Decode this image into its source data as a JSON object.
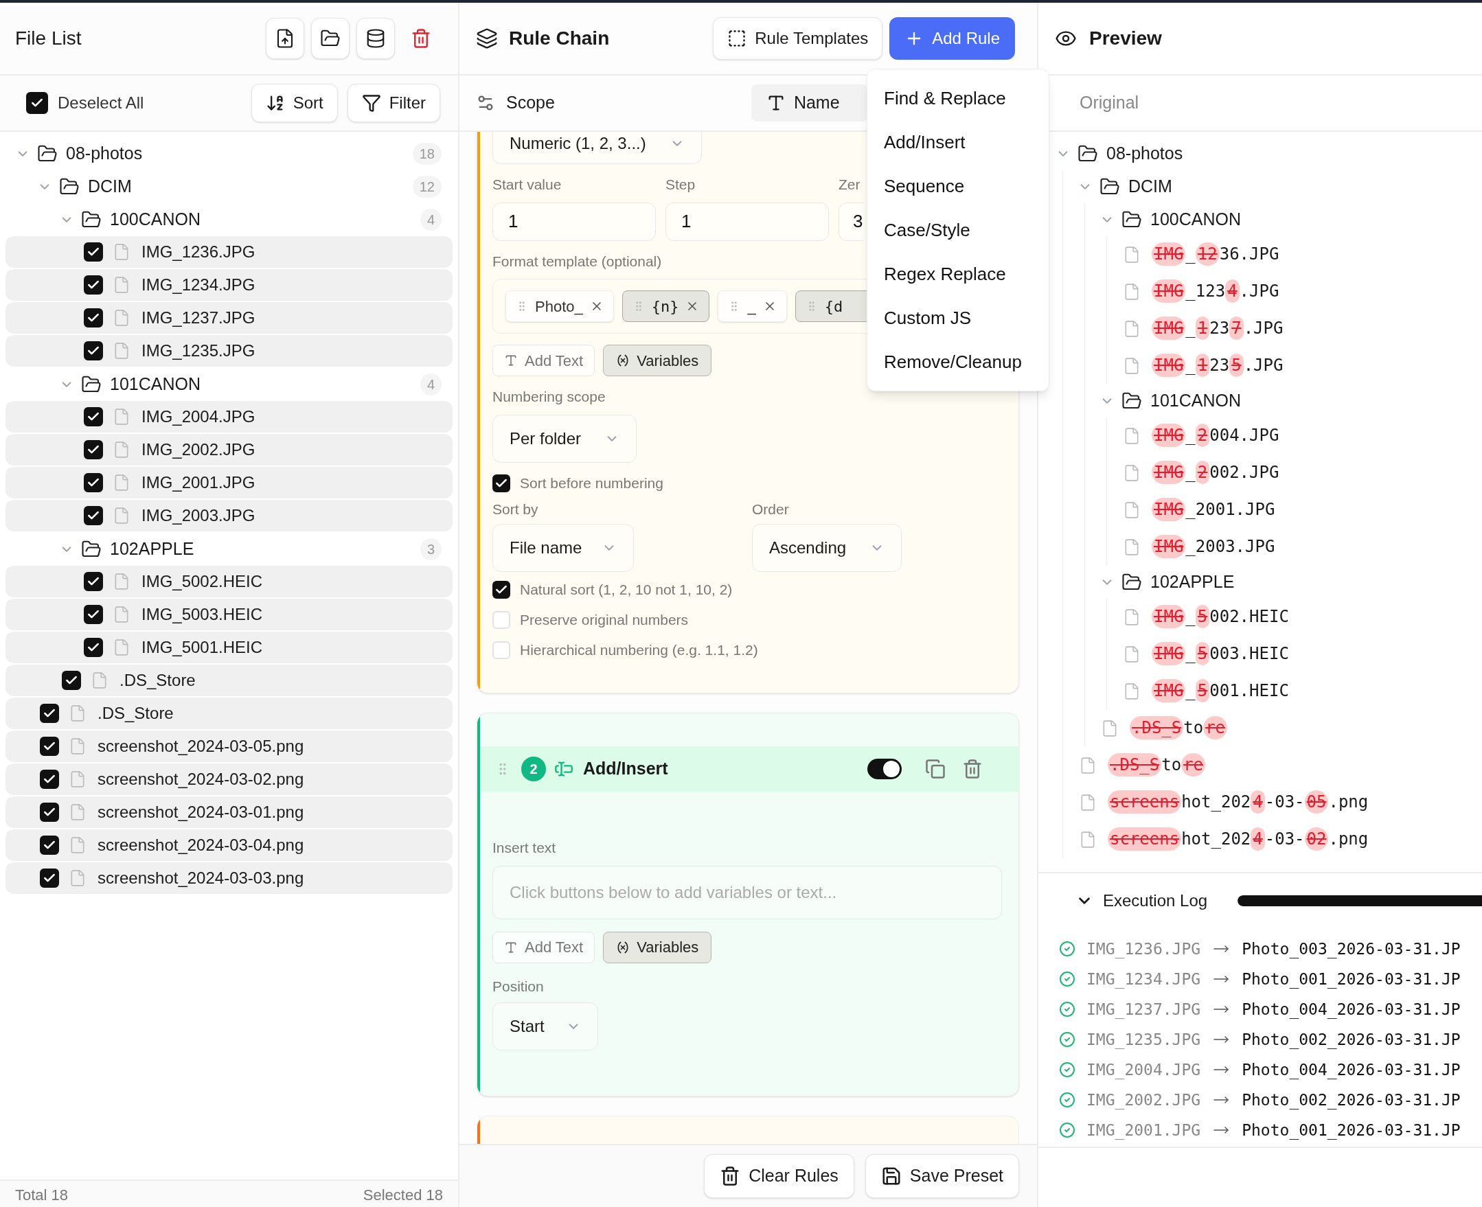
{
  "file_list": {
    "title": "File List",
    "select_all": {
      "label": "Deselect All",
      "checked": true
    },
    "sort_button": "Sort",
    "filter_button": "Filter",
    "tree": [
      {
        "kind": "folder",
        "name": "08-photos",
        "count": "18",
        "expanded": true,
        "children": [
          {
            "kind": "folder",
            "name": "DCIM",
            "count": "12",
            "expanded": true,
            "children": [
              {
                "kind": "folder",
                "name": "100CANON",
                "count": "4",
                "expanded": true,
                "children": [
                  {
                    "kind": "file",
                    "name": "IMG_1236.JPG",
                    "checked": true
                  },
                  {
                    "kind": "file",
                    "name": "IMG_1234.JPG",
                    "checked": true
                  },
                  {
                    "kind": "file",
                    "name": "IMG_1237.JPG",
                    "checked": true
                  },
                  {
                    "kind": "file",
                    "name": "IMG_1235.JPG",
                    "checked": true
                  }
                ]
              },
              {
                "kind": "folder",
                "name": "101CANON",
                "count": "4",
                "expanded": true,
                "children": [
                  {
                    "kind": "file",
                    "name": "IMG_2004.JPG",
                    "checked": true
                  },
                  {
                    "kind": "file",
                    "name": "IMG_2002.JPG",
                    "checked": true
                  },
                  {
                    "kind": "file",
                    "name": "IMG_2001.JPG",
                    "checked": true
                  },
                  {
                    "kind": "file",
                    "name": "IMG_2003.JPG",
                    "checked": true
                  }
                ]
              },
              {
                "kind": "folder",
                "name": "102APPLE",
                "count": "3",
                "expanded": true,
                "children": [
                  {
                    "kind": "file",
                    "name": "IMG_5002.HEIC",
                    "checked": true
                  },
                  {
                    "kind": "file",
                    "name": "IMG_5003.HEIC",
                    "checked": true
                  },
                  {
                    "kind": "file",
                    "name": "IMG_5001.HEIC",
                    "checked": true
                  }
                ]
              },
              {
                "kind": "file",
                "name": ".DS_Store",
                "checked": true
              }
            ]
          },
          {
            "kind": "file",
            "name": ".DS_Store",
            "checked": true
          },
          {
            "kind": "file",
            "name": "screenshot_2024-03-05.png",
            "checked": true
          },
          {
            "kind": "file",
            "name": "screenshot_2024-03-02.png",
            "checked": true
          },
          {
            "kind": "file",
            "name": "screenshot_2024-03-01.png",
            "checked": true
          },
          {
            "kind": "file",
            "name": "screenshot_2024-03-04.png",
            "checked": true
          },
          {
            "kind": "file",
            "name": "screenshot_2024-03-03.png",
            "checked": true
          }
        ]
      }
    ],
    "footer": {
      "total": "Total 18",
      "selected": "Selected 18"
    }
  },
  "rule_chain": {
    "title": "Rule Chain",
    "templates_button": "Rule Templates",
    "add_button": "Add Rule",
    "scope_label": "Scope",
    "scope_target": "Name"
  },
  "add_menu": [
    "Find & Replace",
    "Add/Insert",
    "Sequence",
    "Case/Style",
    "Regex Replace",
    "Custom JS",
    "Remove/Cleanup"
  ],
  "rules": [
    {
      "kind": "sequence",
      "color": "#f59e0b",
      "type_select": "Numeric (1, 2, 3...)",
      "inputs": [
        {
          "label": "Start value",
          "value": "1"
        },
        {
          "label": "Step",
          "value": "1"
        },
        {
          "label": "Zer",
          "value": "3"
        }
      ],
      "template_label": "Format template (optional)",
      "chips": [
        {
          "text": "Photo_",
          "kind": "text"
        },
        {
          "text": "{n}",
          "kind": "variable"
        },
        {
          "text": "_",
          "kind": "text"
        },
        {
          "text": "{d",
          "kind": "variable"
        }
      ],
      "add_text": "Add Text",
      "variables": "Variables",
      "scope_label": "Numbering scope",
      "scope_value": "Per folder",
      "options": [
        {
          "label": "Sort before numbering",
          "checked": true
        }
      ],
      "sort_by_label": "Sort by",
      "sort_by": "File name",
      "order_label": "Order",
      "order": "Ascending",
      "sort_options": [
        {
          "label": "Natural sort (1, 2, 10 not 1, 10, 2)",
          "checked": true
        },
        {
          "label": "Preserve original numbers",
          "checked": false
        },
        {
          "label": "Hierarchical numbering (e.g. 1.1, 1.2)",
          "checked": false
        }
      ]
    },
    {
      "kind": "insert",
      "color": "#10b981",
      "number": "2",
      "title": "Add/Insert",
      "enabled": true,
      "insert_label": "Insert text",
      "insert_placeholder": "Click buttons below to add variables or text...",
      "add_text": "Add Text",
      "variables": "Variables",
      "position_label": "Position",
      "position": "Start"
    },
    {
      "kind": "offscreen",
      "color": "#f97316"
    }
  ],
  "rule_footer": {
    "clear": "Clear Rules",
    "save": "Save Preset"
  },
  "preview": {
    "title": "Preview",
    "column": "Original",
    "tree": [
      {
        "kind": "folder",
        "name": "08-photos",
        "expanded": true,
        "children": [
          {
            "kind": "folder",
            "name": "DCIM",
            "expanded": true,
            "children": [
              {
                "kind": "folder",
                "name": "100CANON",
                "expanded": true,
                "children": [
                  {
                    "kind": "file",
                    "segments": [
                      {
                        "text": "IMG",
                        "removed": true
                      },
                      {
                        "text": "_",
                        "removed": false
                      },
                      {
                        "text": "12",
                        "removed": true
                      },
                      {
                        "text": "36.JPG",
                        "removed": false
                      }
                    ]
                  },
                  {
                    "kind": "file",
                    "segments": [
                      {
                        "text": "IMG",
                        "removed": true
                      },
                      {
                        "text": "_123",
                        "removed": false
                      },
                      {
                        "text": "4",
                        "removed": true
                      },
                      {
                        "text": ".JPG",
                        "removed": false
                      }
                    ]
                  },
                  {
                    "kind": "file",
                    "segments": [
                      {
                        "text": "IMG",
                        "removed": true
                      },
                      {
                        "text": "_",
                        "removed": false
                      },
                      {
                        "text": "1",
                        "removed": true
                      },
                      {
                        "text": "23",
                        "removed": false
                      },
                      {
                        "text": "7",
                        "removed": true
                      },
                      {
                        "text": ".JPG",
                        "removed": false
                      }
                    ]
                  },
                  {
                    "kind": "file",
                    "segments": [
                      {
                        "text": "IMG",
                        "removed": true
                      },
                      {
                        "text": "_",
                        "removed": false
                      },
                      {
                        "text": "1",
                        "removed": true
                      },
                      {
                        "text": "23",
                        "removed": false
                      },
                      {
                        "text": "5",
                        "removed": true
                      },
                      {
                        "text": ".JPG",
                        "removed": false
                      }
                    ]
                  }
                ]
              },
              {
                "kind": "folder",
                "name": "101CANON",
                "expanded": true,
                "children": [
                  {
                    "kind": "file",
                    "segments": [
                      {
                        "text": "IMG",
                        "removed": true
                      },
                      {
                        "text": "_",
                        "removed": false
                      },
                      {
                        "text": "2",
                        "removed": true
                      },
                      {
                        "text": "004.JPG",
                        "removed": false
                      }
                    ]
                  },
                  {
                    "kind": "file",
                    "segments": [
                      {
                        "text": "IMG",
                        "removed": true
                      },
                      {
                        "text": "_",
                        "removed": false
                      },
                      {
                        "text": "2",
                        "removed": true
                      },
                      {
                        "text": "002.JPG",
                        "removed": false
                      }
                    ]
                  },
                  {
                    "kind": "file",
                    "segments": [
                      {
                        "text": "IMG",
                        "removed": true
                      },
                      {
                        "text": "_2001.JPG",
                        "removed": false
                      }
                    ]
                  },
                  {
                    "kind": "file",
                    "segments": [
                      {
                        "text": "IMG",
                        "removed": true
                      },
                      {
                        "text": "_2003.JPG",
                        "removed": false
                      }
                    ]
                  }
                ]
              },
              {
                "kind": "folder",
                "name": "102APPLE",
                "expanded": true,
                "children": [
                  {
                    "kind": "file",
                    "segments": [
                      {
                        "text": "IMG",
                        "removed": true
                      },
                      {
                        "text": "_",
                        "removed": false
                      },
                      {
                        "text": "5",
                        "removed": true
                      },
                      {
                        "text": "002.HEIC",
                        "removed": false
                      }
                    ]
                  },
                  {
                    "kind": "file",
                    "segments": [
                      {
                        "text": "IMG",
                        "removed": true
                      },
                      {
                        "text": "_",
                        "removed": false
                      },
                      {
                        "text": "5",
                        "removed": true
                      },
                      {
                        "text": "003.HEIC",
                        "removed": false
                      }
                    ]
                  },
                  {
                    "kind": "file",
                    "segments": [
                      {
                        "text": "IMG",
                        "removed": true
                      },
                      {
                        "text": "_",
                        "removed": false
                      },
                      {
                        "text": "5",
                        "removed": true
                      },
                      {
                        "text": "001.HEIC",
                        "removed": false
                      }
                    ]
                  }
                ]
              },
              {
                "kind": "file",
                "segments": [
                  {
                    "text": ".DS_S",
                    "removed": true
                  },
                  {
                    "text": "to",
                    "removed": false
                  },
                  {
                    "text": "re",
                    "removed": true
                  }
                ]
              }
            ]
          },
          {
            "kind": "file",
            "segments": [
              {
                "text": ".DS_S",
                "removed": true
              },
              {
                "text": "to",
                "removed": false
              },
              {
                "text": "re",
                "removed": true
              }
            ]
          },
          {
            "kind": "file",
            "segments": [
              {
                "text": "screens",
                "removed": true
              },
              {
                "text": "hot_202",
                "removed": false
              },
              {
                "text": "4",
                "removed": true
              },
              {
                "text": "-03-",
                "removed": false
              },
              {
                "text": "05",
                "removed": true
              },
              {
                "text": ".png",
                "removed": false
              }
            ]
          },
          {
            "kind": "file",
            "segments": [
              {
                "text": "screens",
                "removed": true
              },
              {
                "text": "hot_202",
                "removed": false
              },
              {
                "text": "4",
                "removed": true
              },
              {
                "text": "-03-",
                "removed": false
              },
              {
                "text": "02",
                "removed": true
              },
              {
                "text": ".png",
                "removed": false
              }
            ]
          }
        ]
      }
    ]
  },
  "execution_log": {
    "title": "Execution Log",
    "expanded": true,
    "progress": {
      "level": 1
    },
    "entries": [
      {
        "from": "IMG_1236.JPG",
        "to": "Photo_003_2026-03-31.JP"
      },
      {
        "from": "IMG_1234.JPG",
        "to": "Photo_001_2026-03-31.JP"
      },
      {
        "from": "IMG_1237.JPG",
        "to": "Photo_004_2026-03-31.JP"
      },
      {
        "from": "IMG_1235.JPG",
        "to": "Photo_002_2026-03-31.JP"
      },
      {
        "from": "IMG_2004.JPG",
        "to": "Photo_004_2026-03-31.JP"
      },
      {
        "from": "IMG_2002.JPG",
        "to": "Photo_002_2026-03-31.JP"
      },
      {
        "from": "IMG_2001.JPG",
        "to": "Photo_001_2026-03-31.JP"
      }
    ]
  }
}
